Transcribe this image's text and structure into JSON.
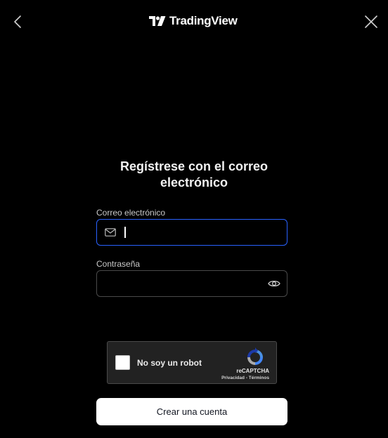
{
  "header": {
    "brand": "TradingView",
    "back_icon": "chevron-left-icon",
    "close_icon": "close-icon"
  },
  "form": {
    "title_line1": "Regístrese con el correo",
    "title_line2": "electrónico",
    "email_label": "Correo electrónico",
    "email_value": "",
    "password_label": "Contraseña",
    "password_value": ""
  },
  "recaptcha": {
    "label": "No soy un robot",
    "brand": "reCAPTCHA",
    "links": "Privacidad - Términos"
  },
  "submit": {
    "label": "Crear una cuenta"
  },
  "colors": {
    "background": "#000000",
    "focus_border": "#2962ff",
    "button_bg": "#ffffff"
  }
}
